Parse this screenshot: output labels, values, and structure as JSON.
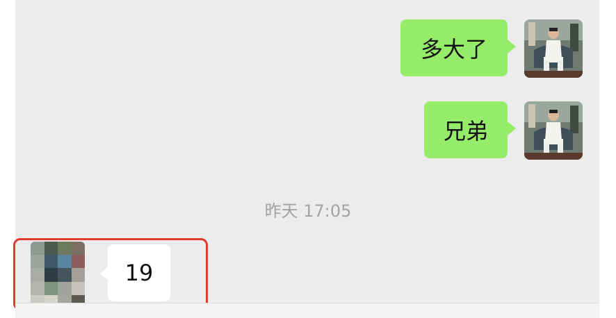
{
  "messages": [
    {
      "direction": "out",
      "text": "多大了",
      "avatar": "sender-avatar"
    },
    {
      "direction": "out",
      "text": "兄弟",
      "avatar": "sender-avatar"
    },
    {
      "direction": "in",
      "text": "19",
      "avatar": "pixelated-avatar"
    }
  ],
  "timestamp": "昨天 17:05",
  "colors": {
    "chat_background": "#ececed",
    "outgoing_bubble": "#95ec69",
    "incoming_bubble": "#ffffff",
    "timestamp_text": "#a3a3a3",
    "highlight_border": "#e1392e"
  }
}
